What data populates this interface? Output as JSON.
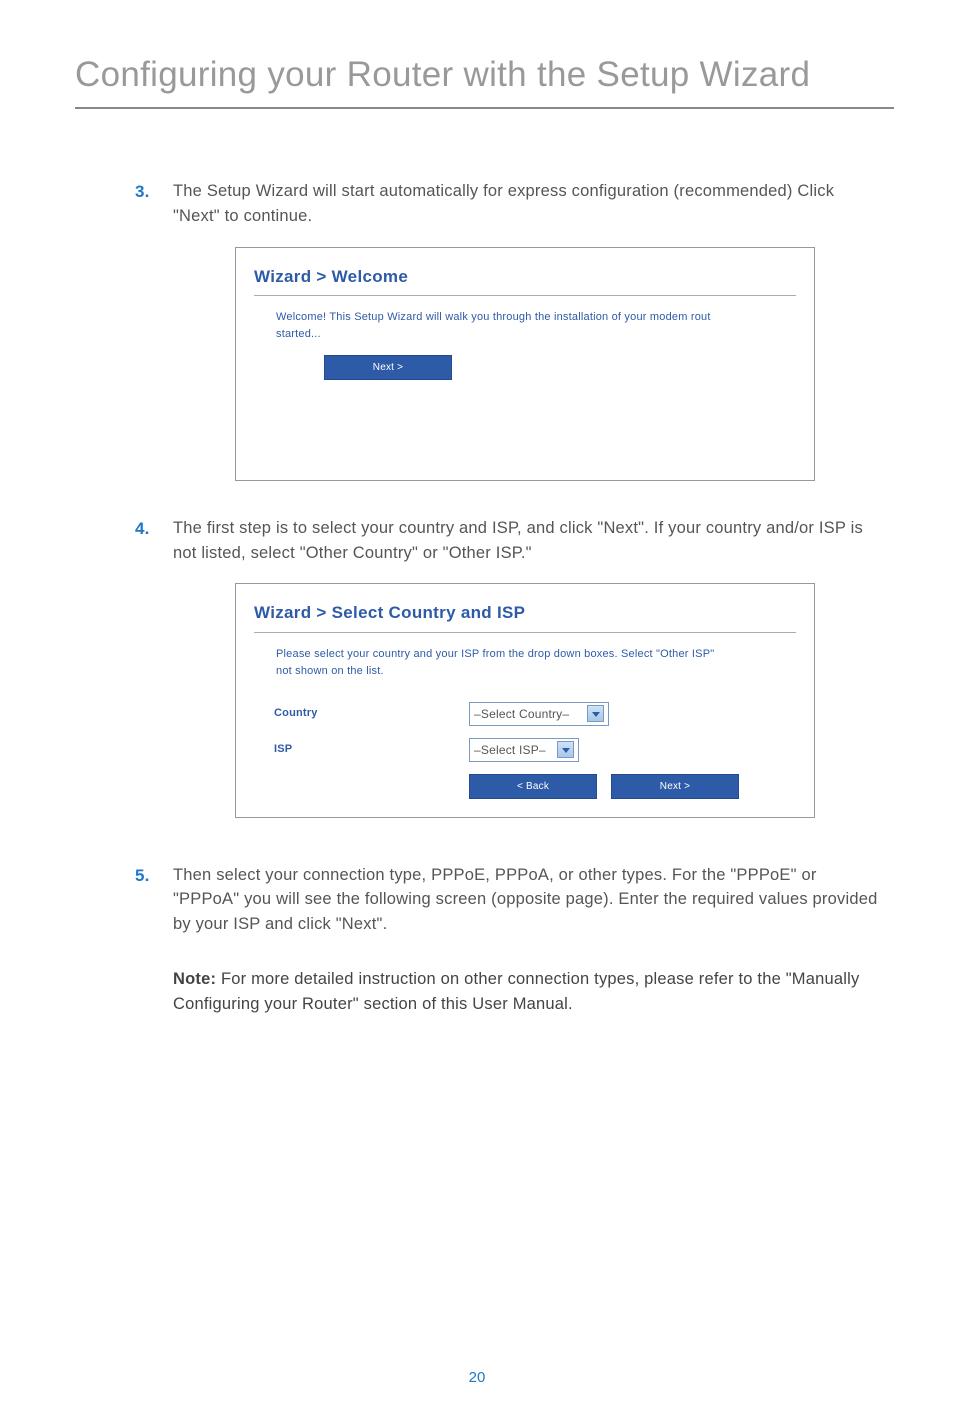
{
  "page": {
    "title": "Configuring your Router with the Setup Wizard",
    "number": "20"
  },
  "steps": {
    "s3": {
      "num": "3.",
      "text": "The Setup Wizard will start automatically for express configuration (recommended) Click \"Next\" to continue."
    },
    "s4": {
      "num": "4.",
      "text": "The first step is to select your country and ISP, and click \"Next\". If your country and/or ISP is not listed, select \"Other Country\" or \"Other ISP.\""
    },
    "s5": {
      "num": "5.",
      "text": "Then select your connection type, PPPoE, PPPoA, or other types. For the \"PPPoE\" or \"PPPoA\" you will see the following screen (opposite page). Enter the required values provided by your ISP and click \"Next\"."
    }
  },
  "wizard_welcome": {
    "heading": "Wizard > Welcome",
    "body": "Welcome! This Setup Wizard will walk you through the installation of your modem rout",
    "started": "started...",
    "next_btn": "Next >"
  },
  "wizard_isp": {
    "heading": "Wizard > Select Country and ISP",
    "instruction": "Please select your country and your ISP from the drop down boxes. Select \"Other ISP\"",
    "instruction2": "not shown on the list.",
    "country_label": "Country",
    "country_value": "–Select Country–",
    "isp_label": "ISP",
    "isp_value": "–Select ISP–",
    "back_btn": "< Back",
    "next_btn": "Next >"
  },
  "note": {
    "label": "Note:",
    "text": " For more detailed instruction on other connection types, please refer to the \"Manually Configuring your Router\" section of this User Manual."
  }
}
